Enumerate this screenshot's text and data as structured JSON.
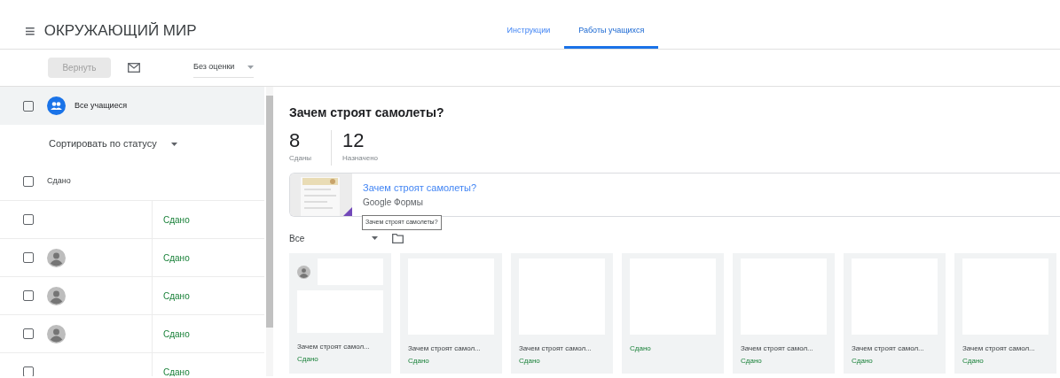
{
  "header": {
    "menu_icon": "≡",
    "title": "ОКРУЖАЮЩИЙ МИР"
  },
  "tabs": [
    {
      "label": "Инструкции",
      "selected": false
    },
    {
      "label": "Работы учащихся",
      "selected": true
    }
  ],
  "toolbar": {
    "return_button": {
      "label": "Вернуть",
      "disabled": true
    },
    "grade_select": "Без оценки"
  },
  "student_list": {
    "all_students": {
      "label": "Все учащиеся",
      "checked": false
    },
    "sort": "Сортировать по статусу",
    "group": {
      "label": "Сдано",
      "checked": false
    },
    "students": [
      {
        "avatar": false,
        "status": "Сдано",
        "checked": false
      },
      {
        "avatar": true,
        "status": "Сдано",
        "checked": false
      },
      {
        "avatar": true,
        "status": "Сдано",
        "checked": false
      },
      {
        "avatar": true,
        "status": "Сдано",
        "checked": false
      },
      {
        "avatar": false,
        "status": "Сдано",
        "checked": false
      }
    ]
  },
  "assignment": {
    "title": "Зачем строят самолеты?",
    "stats": [
      {
        "count": "8",
        "label": "Сданы"
      },
      {
        "count": "12",
        "label": "Назначено"
      }
    ],
    "attachment": {
      "title": "Зачем строят самолеты?",
      "source": "Google Формы",
      "tooltip": "Зачем строят самолеты?"
    },
    "filter": "Все",
    "submissions": [
      {
        "avatar": true,
        "title": "Зачем строят самол...",
        "status": "Сдано"
      },
      {
        "avatar": false,
        "title": "Зачем строят самол...",
        "status": "Сдано"
      },
      {
        "avatar": false,
        "title": "Зачем строят самол...",
        "status": "Сдано"
      },
      {
        "avatar": false,
        "status": "Сдано"
      },
      {
        "avatar": false,
        "title": "Зачем строят самол...",
        "status": "Сдано"
      },
      {
        "avatar": false,
        "title": "Зачем строят самол...",
        "status": "Сдано"
      },
      {
        "avatar": false,
        "title": "Зачем строят самол...",
        "status": "Сдано"
      }
    ]
  }
}
